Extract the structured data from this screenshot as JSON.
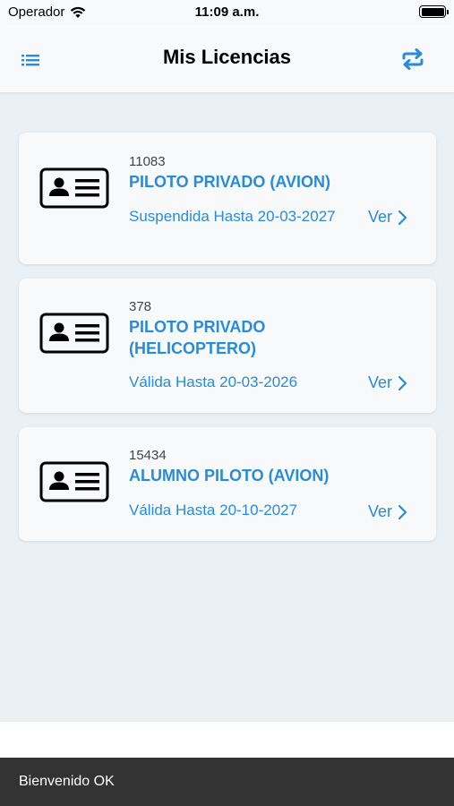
{
  "status_bar": {
    "carrier": "Operador",
    "time": "11:09 a.m.",
    "wifi_icon": "wifi-icon",
    "battery_icon": "battery-icon"
  },
  "nav": {
    "title": "Mis Licencias",
    "menu_icon": "list-menu-icon",
    "sync_icon": "sync-arrows-icon"
  },
  "colors": {
    "accent": "#2a8bd6",
    "background": "#eaf0f4",
    "card": "#f7f9fb",
    "toast": "#333333"
  },
  "licenses": [
    {
      "number": "11083",
      "title": "PILOTO PRIVADO (AVION)",
      "status": "Suspendida Hasta 20-03-2027",
      "action": "Ver",
      "icon": "id-card-icon"
    },
    {
      "number": "378",
      "title": "PILOTO PRIVADO (HELICOPTERO)",
      "status": "Válida Hasta 20-03-2026",
      "action": "Ver",
      "icon": "id-card-icon"
    },
    {
      "number": "15434",
      "title": "ALUMNO PILOTO (AVION)",
      "status": "Válida Hasta 20-10-2027",
      "action": "Ver",
      "icon": "id-card-icon"
    }
  ],
  "toast": {
    "message": "Bienvenido OK"
  }
}
